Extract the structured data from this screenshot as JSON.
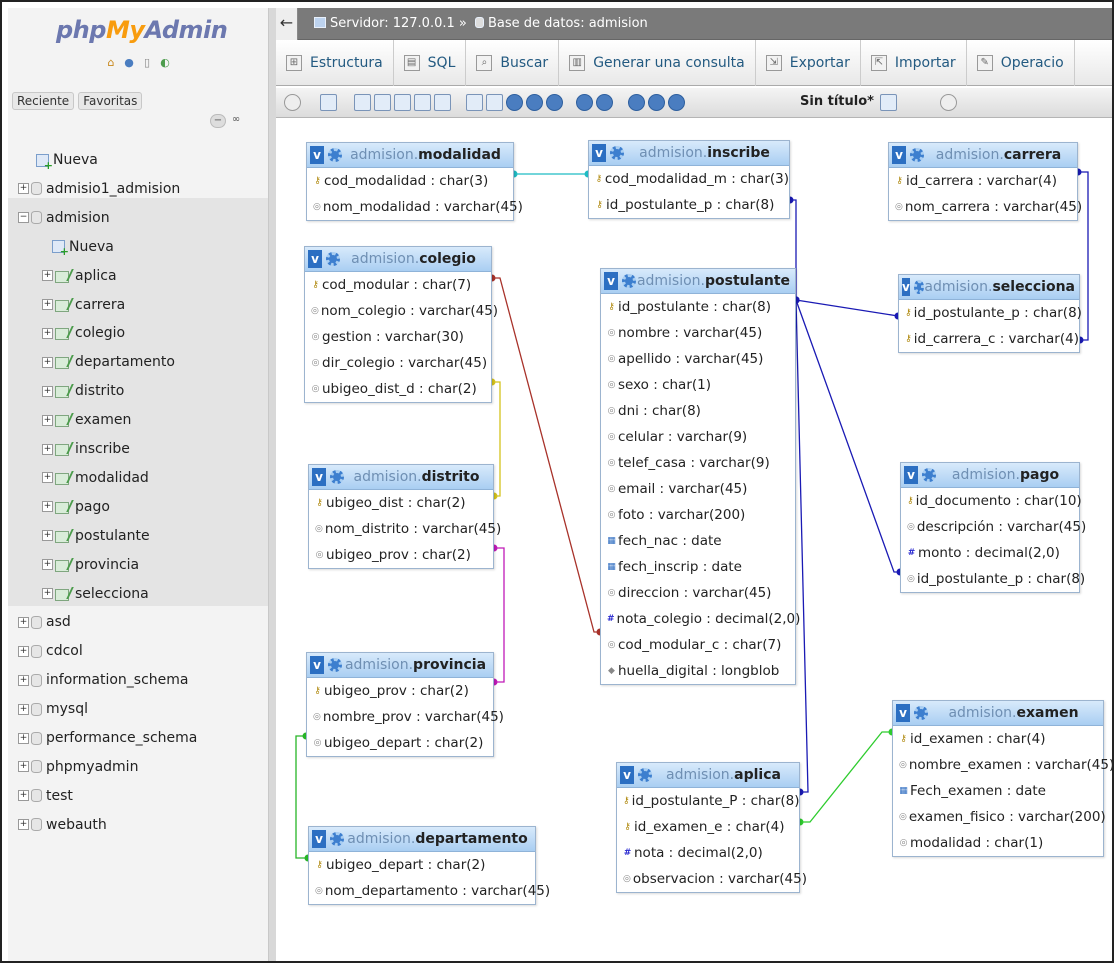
{
  "sidebar": {
    "logo": {
      "php": "php",
      "my": "My",
      "admin": "Admin"
    },
    "recent_label": "Reciente",
    "favorites_label": "Favoritas",
    "new_label": "Nueva",
    "databases": [
      {
        "name": "admisio1_admision"
      },
      {
        "name": "admision"
      },
      {
        "name": "asd"
      },
      {
        "name": "cdcol"
      },
      {
        "name": "information_schema"
      },
      {
        "name": "mysql"
      },
      {
        "name": "performance_schema"
      },
      {
        "name": "phpmyadmin"
      },
      {
        "name": "test"
      },
      {
        "name": "webauth"
      }
    ],
    "admision_new": "Nueva",
    "admision_tables": [
      "aplica",
      "carrera",
      "colegio",
      "departamento",
      "distrito",
      "examen",
      "inscribe",
      "modalidad",
      "pago",
      "postulante",
      "provincia",
      "selecciona"
    ]
  },
  "topbar": {
    "server": "Servidor: 127.0.0.1 »",
    "database": "Base de datos: admision"
  },
  "tabs": [
    {
      "label": "Estructura",
      "icon": "structure-icon"
    },
    {
      "label": "SQL",
      "icon": "sql-icon"
    },
    {
      "label": "Buscar",
      "icon": "search-icon"
    },
    {
      "label": "Generar una consulta",
      "icon": "query-icon"
    },
    {
      "label": "Exportar",
      "icon": "export-icon"
    },
    {
      "label": "Importar",
      "icon": "import-icon"
    },
    {
      "label": "Operacio",
      "icon": "wrench-icon"
    }
  ],
  "designer": {
    "page_title": "Sin título*"
  },
  "tables": {
    "modalidad": {
      "db": "admision.",
      "name": "modalidad",
      "fields": [
        {
          "icon": "key",
          "text": "cod_modalidad : char(3)"
        },
        {
          "icon": "field",
          "text": "nom_modalidad : varchar(45)"
        }
      ]
    },
    "inscribe": {
      "db": "admision.",
      "name": "inscribe",
      "fields": [
        {
          "icon": "key",
          "text": "cod_modalidad_m : char(3)"
        },
        {
          "icon": "key",
          "text": "id_postulante_p : char(8)"
        }
      ]
    },
    "carrera": {
      "db": "admision.",
      "name": "carrera",
      "fields": [
        {
          "icon": "key",
          "text": "id_carrera : varchar(4)"
        },
        {
          "icon": "field",
          "text": "nom_carrera : varchar(45)"
        }
      ]
    },
    "colegio": {
      "db": "admision.",
      "name": "colegio",
      "fields": [
        {
          "icon": "key",
          "text": "cod_modular : char(7)"
        },
        {
          "icon": "field",
          "text": "nom_colegio : varchar(45)"
        },
        {
          "icon": "field",
          "text": "gestion : varchar(30)"
        },
        {
          "icon": "field",
          "text": "dir_colegio : varchar(45)"
        },
        {
          "icon": "field",
          "text": "ubigeo_dist_d : char(2)"
        }
      ]
    },
    "postulante": {
      "db": "admision.",
      "name": "postulante",
      "fields": [
        {
          "icon": "key",
          "text": "id_postulante : char(8)"
        },
        {
          "icon": "field",
          "text": "nombre : varchar(45)"
        },
        {
          "icon": "field",
          "text": "apellido : varchar(45)"
        },
        {
          "icon": "field",
          "text": "sexo : char(1)"
        },
        {
          "icon": "field",
          "text": "dni : char(8)"
        },
        {
          "icon": "field",
          "text": "celular : varchar(9)"
        },
        {
          "icon": "field",
          "text": "telef_casa : varchar(9)"
        },
        {
          "icon": "field",
          "text": "email : varchar(45)"
        },
        {
          "icon": "field",
          "text": "foto : varchar(200)"
        },
        {
          "icon": "date",
          "text": "fech_nac : date"
        },
        {
          "icon": "date",
          "text": "fech_inscrip : date"
        },
        {
          "icon": "field",
          "text": "direccion : varchar(45)"
        },
        {
          "icon": "num",
          "text": "nota_colegio : decimal(2,0)"
        },
        {
          "icon": "field",
          "text": "cod_modular_c : char(7)"
        },
        {
          "icon": "blob",
          "text": "huella_digital : longblob"
        }
      ]
    },
    "selecciona": {
      "db": "admision.",
      "name": "selecciona",
      "fields": [
        {
          "icon": "key",
          "text": "id_postulante_p : char(8)"
        },
        {
          "icon": "key",
          "text": "id_carrera_c : varchar(4)"
        }
      ]
    },
    "distrito": {
      "db": "admision.",
      "name": "distrito",
      "fields": [
        {
          "icon": "key",
          "text": "ubigeo_dist : char(2)"
        },
        {
          "icon": "field",
          "text": "nom_distrito : varchar(45)"
        },
        {
          "icon": "field",
          "text": "ubigeo_prov : char(2)"
        }
      ]
    },
    "pago": {
      "db": "admision.",
      "name": "pago",
      "fields": [
        {
          "icon": "key",
          "text": "id_documento : char(10)"
        },
        {
          "icon": "field",
          "text": "descripción : varchar(45)"
        },
        {
          "icon": "num",
          "text": "monto : decimal(2,0)"
        },
        {
          "icon": "field",
          "text": "id_postulante_p : char(8)"
        }
      ]
    },
    "provincia": {
      "db": "admision.",
      "name": "provincia",
      "fields": [
        {
          "icon": "key",
          "text": "ubigeo_prov : char(2)"
        },
        {
          "icon": "field",
          "text": "nombre_prov : varchar(45)"
        },
        {
          "icon": "field",
          "text": "ubigeo_depart : char(2)"
        }
      ]
    },
    "examen": {
      "db": "admision.",
      "name": "examen",
      "fields": [
        {
          "icon": "key",
          "text": "id_examen : char(4)"
        },
        {
          "icon": "field",
          "text": "nombre_examen : varchar(45)"
        },
        {
          "icon": "date",
          "text": "Fech_examen : date"
        },
        {
          "icon": "field",
          "text": "examen_fisico : varchar(200)"
        },
        {
          "icon": "field",
          "text": "modalidad : char(1)"
        }
      ]
    },
    "aplica": {
      "db": "admision.",
      "name": "aplica",
      "fields": [
        {
          "icon": "key",
          "text": "id_postulante_P : char(8)"
        },
        {
          "icon": "key",
          "text": "id_examen_e : char(4)"
        },
        {
          "icon": "num",
          "text": "nota : decimal(2,0)"
        },
        {
          "icon": "field",
          "text": "observacion : varchar(45)"
        }
      ]
    },
    "departamento": {
      "db": "admision.",
      "name": "departamento",
      "fields": [
        {
          "icon": "key",
          "text": "ubigeo_depart : char(2)"
        },
        {
          "icon": "field",
          "text": "nom_departamento : varchar(45)"
        }
      ]
    }
  },
  "relation_colors": {
    "modalidad": "#1fbcc4",
    "colegio": "#a8322a",
    "distrito": "#d4c21c",
    "provincia": "#c01ab8",
    "departamento": "#27b527",
    "postulante": "#1a1ab4",
    "carrera": "#1a1ab4",
    "examen": "#2ecc2e"
  }
}
